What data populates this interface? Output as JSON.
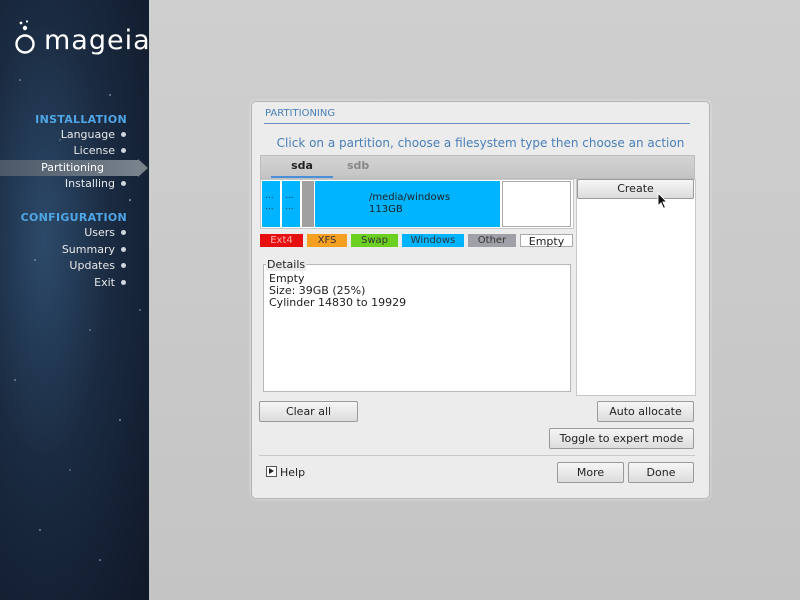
{
  "sidebar": {
    "brand": "mageia",
    "installation_title": "INSTALLATION",
    "configuration_title": "CONFIGURATION",
    "installation_items": [
      {
        "label": "Language"
      },
      {
        "label": "License"
      },
      {
        "label": "Partitioning"
      },
      {
        "label": "Installing"
      }
    ],
    "configuration_items": [
      {
        "label": "Users"
      },
      {
        "label": "Summary"
      },
      {
        "label": "Updates"
      },
      {
        "label": "Exit"
      }
    ],
    "active_item": "Partitioning"
  },
  "dialog": {
    "title": "PARTITIONING",
    "instruction": "Click on a partition, choose a filesystem type then choose an action",
    "tabs": [
      {
        "label": "sda"
      },
      {
        "label": "sdb"
      }
    ],
    "active_tab": "sda",
    "partitions": {
      "p1": "...",
      "p2": "...",
      "windows_mount": "/media/windows",
      "windows_size": "113GB"
    },
    "legend": {
      "ext4": "Ext4",
      "xfs": "XFS",
      "swap": "Swap",
      "windows": "Windows",
      "other": "Other",
      "empty": "Empty"
    },
    "details": {
      "legend": "Details",
      "line1": "Empty",
      "line2": "Size: 39GB (25%)",
      "line3": "Cylinder 14830 to 19929"
    },
    "buttons": {
      "create": "Create",
      "clear_all": "Clear all",
      "auto_allocate": "Auto allocate",
      "expert_mode": "Toggle to expert mode",
      "more": "More",
      "done": "Done",
      "help": "Help"
    }
  },
  "colors": {
    "ext4": "#e61010",
    "xfs": "#f5a020",
    "swap": "#6cd020",
    "windows": "#00b4ff",
    "other": "#a0a0a8",
    "accent": "#4a7fb8"
  },
  "icons": [
    "mageia-logo-icon",
    "help-expander-icon",
    "mouse-pointer-icon"
  ]
}
